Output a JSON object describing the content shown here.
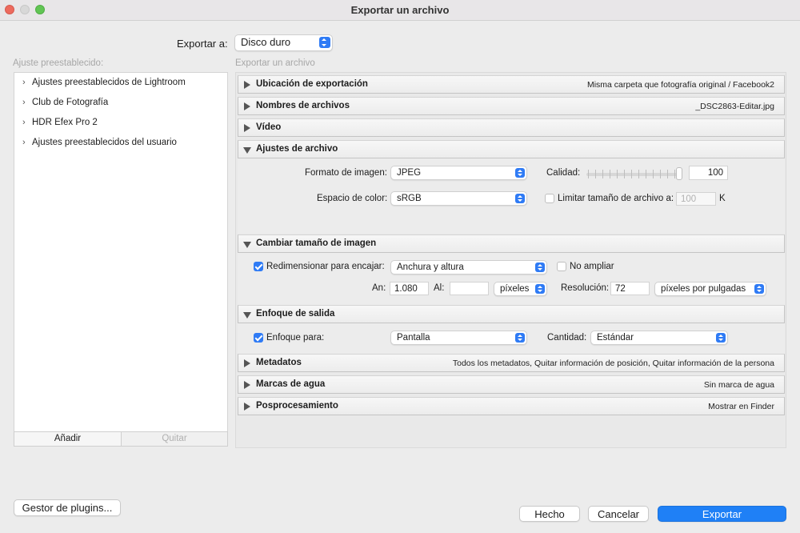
{
  "window": {
    "title": "Exportar un archivo"
  },
  "export_to": {
    "label": "Exportar a:",
    "value": "Disco duro"
  },
  "presets": {
    "label": "Ajuste preestablecido:",
    "items": [
      "Ajustes preestablecidos de Lightroom",
      "Club de Fotografía",
      "HDR Efex Pro 2",
      "Ajustes preestablecidos del usuario"
    ],
    "add_label": "Añadir",
    "remove_label": "Quitar"
  },
  "export_panel_label": "Exportar un archivo",
  "sections": {
    "location": {
      "title": "Ubicación de exportación",
      "summary": "Misma carpeta que fotografía original / Facebook2"
    },
    "filenames": {
      "title": "Nombres de archivos",
      "summary": "_DSC2863-Editar.jpg"
    },
    "video": {
      "title": "Vídeo"
    },
    "file_settings": {
      "title": "Ajustes de archivo",
      "format_label": "Formato de imagen:",
      "format_value": "JPEG",
      "quality_label": "Calidad:",
      "quality_value": "100",
      "colorspace_label": "Espacio de color:",
      "colorspace_value": "sRGB",
      "limit_label": "Limitar tamaño de archivo a:",
      "limit_value": "100",
      "limit_unit": "K"
    },
    "resize": {
      "title": "Cambiar tamaño de imagen",
      "fit_label": "Redimensionar para encajar:",
      "fit_value": "Anchura y altura",
      "no_enlarge_label": "No ampliar",
      "width_label": "An:",
      "width_value": "1.080",
      "height_label": "Al:",
      "height_value": "",
      "unit_value": "píxeles",
      "resolution_label": "Resolución:",
      "resolution_value": "72",
      "resolution_unit": "píxeles por pulgadas"
    },
    "sharpen": {
      "title": "Enfoque de salida",
      "sharpen_label": "Enfoque para:",
      "sharpen_value": "Pantalla",
      "amount_label": "Cantidad:",
      "amount_value": "Estándar"
    },
    "metadata": {
      "title": "Metadatos",
      "summary": "Todos los metadatos, Quitar información de posición, Quitar información de la persona"
    },
    "watermark": {
      "title": "Marcas de agua",
      "summary": "Sin marca de agua"
    },
    "postprocess": {
      "title": "Posprocesamiento",
      "summary": "Mostrar en Finder"
    }
  },
  "footer": {
    "plugins_label": "Gestor de plugins...",
    "done_label": "Hecho",
    "cancel_label": "Cancelar",
    "export_label": "Exportar"
  },
  "colors": {
    "accent": "#1f80f6",
    "close": "#ed6a5e",
    "maximize": "#61c554"
  }
}
